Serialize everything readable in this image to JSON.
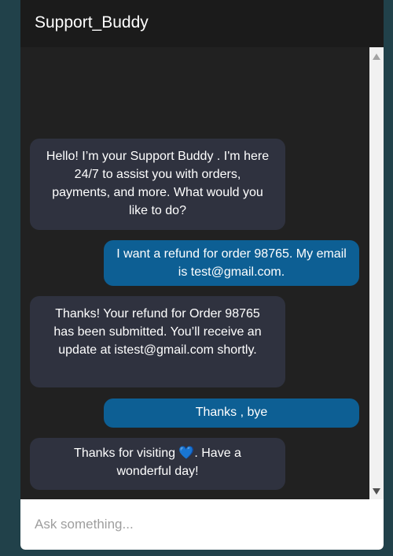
{
  "header": {
    "title": "Support_Buddy"
  },
  "messages": [
    {
      "sender": "bot",
      "text": "Hello! I’m your Support Buddy . I'm here 24/7 to assist you with orders, payments, and more. What would you like to do?"
    },
    {
      "sender": "user",
      "text": "I want a refund for order 98765. My email is test@gmail.com."
    },
    {
      "sender": "bot",
      "text": "Thanks! Your refund for Order 98765 has been submitted. You’ll receive an update at istest@gmail.com shortly."
    },
    {
      "sender": "user",
      "text": "Thanks , bye"
    },
    {
      "sender": "bot",
      "text": "Thanks for visiting 💙. Have a wonderful day!"
    }
  ],
  "input": {
    "placeholder": "Ask something...",
    "value": ""
  },
  "colors": {
    "bot_bubble": "#2f323f",
    "user_bubble": "#0d5f94",
    "chat_background": "#212121",
    "page_background": "#21414a"
  }
}
